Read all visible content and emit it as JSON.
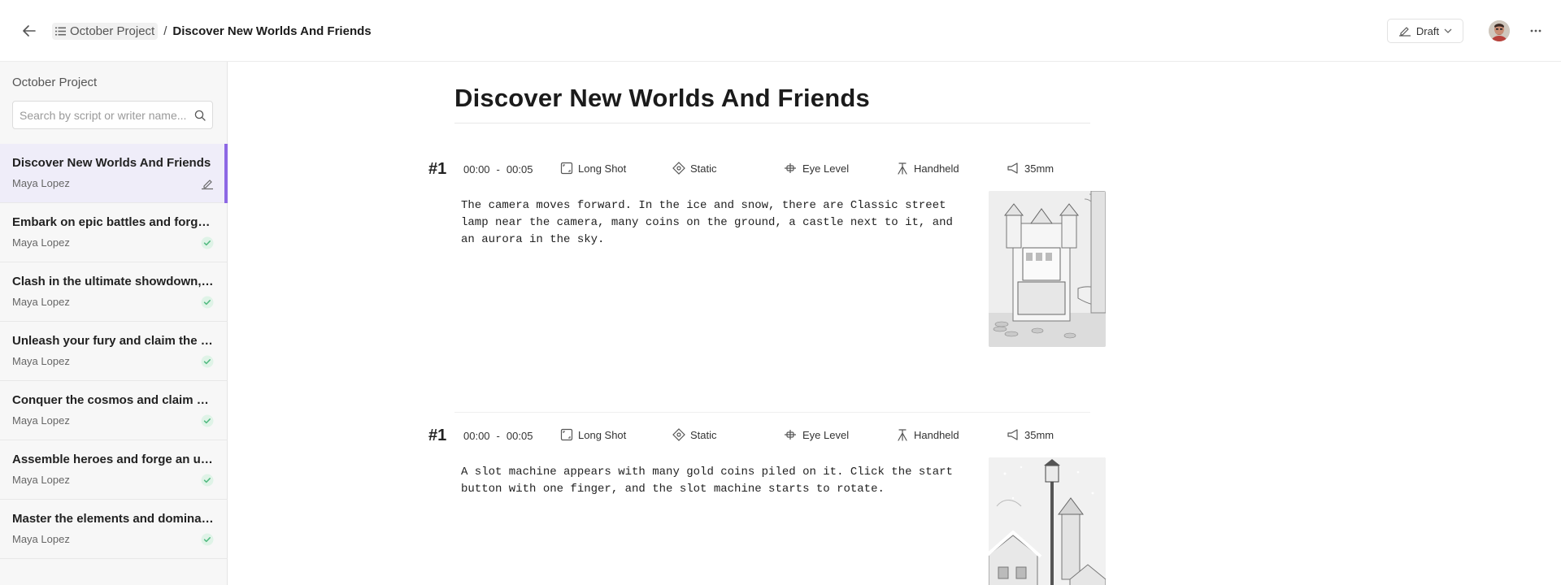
{
  "header": {
    "project_crumb": "October Project",
    "separator": "/",
    "current_crumb": "Discover New Worlds And Friends",
    "draft_label": "Draft"
  },
  "sidebar": {
    "title": "October Project",
    "search_placeholder": "Search by script or writer name...",
    "items": [
      {
        "title": "Discover New Worlds And Friends",
        "writer": "Maya Lopez",
        "status": "draft",
        "status_icon": "edit-signature-icon"
      },
      {
        "title": "Embark on epic battles and forge your legend",
        "writer": "Maya Lopez",
        "status": "done",
        "status_icon": "check-circle-icon"
      },
      {
        "title": "Clash in the ultimate showdown, win glory",
        "writer": "Maya Lopez",
        "status": "done",
        "status_icon": "check-circle-icon"
      },
      {
        "title": "Unleash your fury and claim the title",
        "writer": "Maya Lopez",
        "status": "done",
        "status_icon": "check-circle-icon"
      },
      {
        "title": "Conquer the cosmos and claim galactic glory",
        "writer": "Maya Lopez",
        "status": "done",
        "status_icon": "check-circle-icon"
      },
      {
        "title": "Assemble heroes and forge an unforgettable tale",
        "writer": "Maya Lopez",
        "status": "done",
        "status_icon": "check-circle-icon"
      },
      {
        "title": "Master the elements and dominate the arena",
        "writer": "Maya Lopez",
        "status": "done",
        "status_icon": "check-circle-icon"
      }
    ]
  },
  "main": {
    "title": "Discover New Worlds And Friends",
    "shots": [
      {
        "number": "#1",
        "start": "00:00",
        "end": "00:05",
        "shot_size": "Long Shot",
        "movement": "Static",
        "angle": "Eye Level",
        "rig": "Handheld",
        "lens": "35mm",
        "description": "The camera moves forward. In the ice and snow, there are Classic street lamp near the camera, many coins on the ground, a castle next to it, and an aurora in the sky.",
        "image_subject": "sketch of a castle with a slot machine and coins"
      },
      {
        "number": "#1",
        "start": "00:00",
        "end": "00:05",
        "shot_size": "Long Shot",
        "movement": "Static",
        "angle": "Eye Level",
        "rig": "Handheld",
        "lens": "35mm",
        "description": "A slot machine appears with many gold coins piled on it. Click the start button with one finger, and the slot machine starts to rotate.",
        "image_subject": "sketch of a snowy village with a street lamp"
      }
    ]
  },
  "colors": {
    "accent": "#8d68e4",
    "active_bg": "#efedf9",
    "check_green": "#5cc48a",
    "check_bg": "#dff3e7"
  }
}
